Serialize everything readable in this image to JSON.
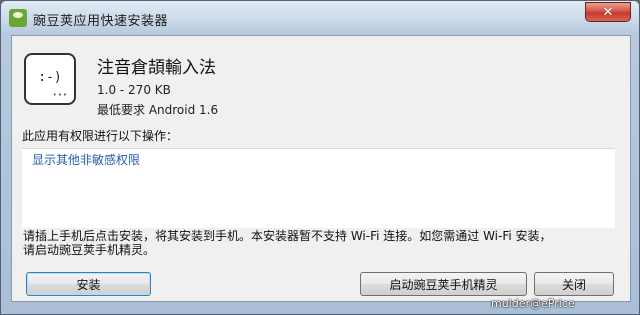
{
  "window": {
    "title": "豌豆荚应用快速安装器",
    "close_glyph": "✕"
  },
  "app": {
    "icon_glyph": ":-)",
    "icon_dots": "•••",
    "name": "注音倉頡輸入法",
    "version_size": "1.0 - 270 KB",
    "requirement": "最低要求 Android 1.6"
  },
  "permissions": {
    "title": "此应用有权限进行以下操作：",
    "items": [
      "显示其他非敏感权限"
    ]
  },
  "note": {
    "line1": "请插上手机后点击安装，将其安装到手机。本安装器暂不支持 Wi-Fi 连接。如您需通过 Wi-Fi 安装，",
    "line2": "请启动豌豆荚手机精灵。"
  },
  "buttons": {
    "install": "安装",
    "launch": "启动豌豆荚手机精灵",
    "close": "关闭"
  },
  "watermark": "mulder@ePrice"
}
